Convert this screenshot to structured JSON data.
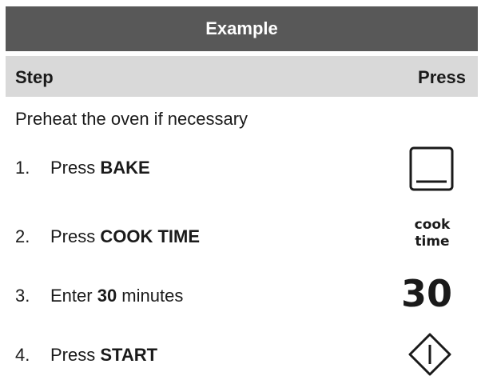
{
  "title": "Example",
  "header": {
    "step": "Step",
    "press": "Press"
  },
  "intro": "Preheat the oven if necessary",
  "steps": [
    {
      "number": "1.",
      "prefix": "Press ",
      "bold": "BAKE",
      "suffix": ""
    },
    {
      "number": "2.",
      "prefix": "Press ",
      "bold": "COOK TIME",
      "suffix": ""
    },
    {
      "number": "3.",
      "prefix": "Enter ",
      "bold": "30",
      "suffix": " minutes"
    },
    {
      "number": "4.",
      "prefix": "Press ",
      "bold": "START",
      "suffix": ""
    }
  ],
  "press_keys": {
    "bake_icon": "bake-square-icon",
    "cook_time_line1": "cook",
    "cook_time_line2": "time",
    "number_value": "30",
    "start_icon": "start-diamond-icon"
  },
  "colors": {
    "title_bar_bg": "#585858",
    "header_bg": "#d9d9d9",
    "text": "#1a1a1a"
  }
}
